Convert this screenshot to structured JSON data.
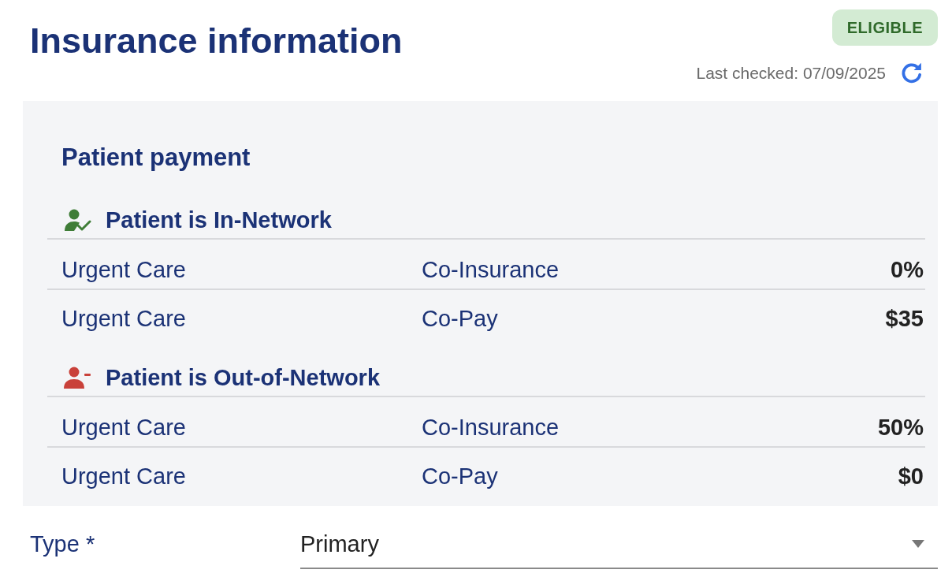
{
  "header": {
    "title": "Insurance information",
    "status_badge": "ELIGIBLE",
    "last_checked": "Last checked: 07/09/2025"
  },
  "patient_payment": {
    "title": "Patient payment",
    "groups": [
      {
        "kind": "in_network",
        "title": "Patient is In-Network",
        "rows": [
          {
            "service": "Urgent Care",
            "benefit": "Co-Insurance",
            "amount": "0%"
          },
          {
            "service": "Urgent Care",
            "benefit": "Co-Pay",
            "amount": "$35"
          }
        ]
      },
      {
        "kind": "out_of_network",
        "title": "Patient is Out-of-Network",
        "rows": [
          {
            "service": "Urgent Care",
            "benefit": "Co-Insurance",
            "amount": "50%"
          },
          {
            "service": "Urgent Care",
            "benefit": "Co-Pay",
            "amount": "$0"
          }
        ]
      }
    ]
  },
  "type_field": {
    "label": "Type *",
    "value": "Primary"
  }
}
